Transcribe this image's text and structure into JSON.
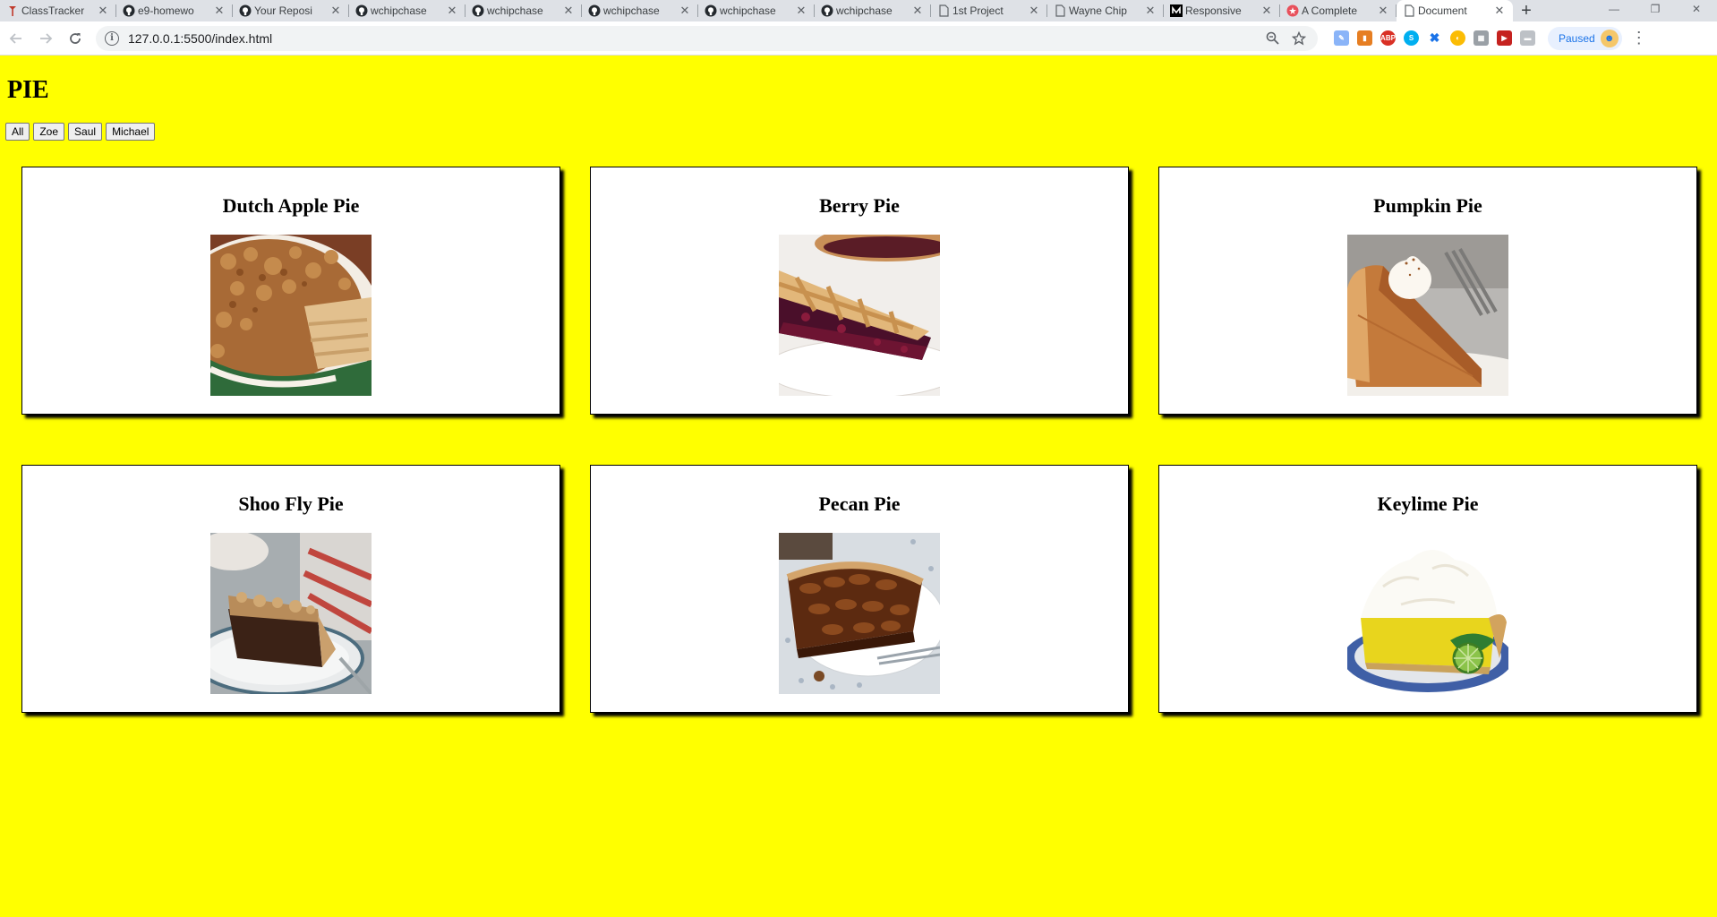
{
  "browser": {
    "tabs": [
      {
        "title": "ClassTracker",
        "icon": "classtracker-icon"
      },
      {
        "title": "e9-homewo",
        "icon": "github-icon"
      },
      {
        "title": "Your Reposi",
        "icon": "github-icon"
      },
      {
        "title": "wchipchase",
        "icon": "github-icon"
      },
      {
        "title": "wchipchase",
        "icon": "github-icon"
      },
      {
        "title": "wchipchase",
        "icon": "github-icon"
      },
      {
        "title": "wchipchase",
        "icon": "github-icon"
      },
      {
        "title": "wchipchase",
        "icon": "github-icon"
      },
      {
        "title": "1st Project",
        "icon": "page-icon"
      },
      {
        "title": "Wayne Chip",
        "icon": "page-icon"
      },
      {
        "title": "Responsive",
        "icon": "medium-icon"
      },
      {
        "title": "A Complete",
        "icon": "star-logo-icon"
      },
      {
        "title": "Document",
        "icon": "page-icon",
        "active": true
      }
    ],
    "url": "127.0.0.1:5500/index.html",
    "paused_label": "Paused"
  },
  "page": {
    "heading": "PIE",
    "filters": [
      "All",
      "Zoe",
      "Saul",
      "Michael"
    ],
    "pies": [
      {
        "name": "Dutch Apple Pie",
        "image": "dutch-apple-pie-photo"
      },
      {
        "name": "Berry Pie",
        "image": "berry-pie-photo"
      },
      {
        "name": "Pumpkin Pie",
        "image": "pumpkin-pie-photo"
      },
      {
        "name": "Shoo Fly Pie",
        "image": "shoo-fly-pie-photo"
      },
      {
        "name": "Pecan Pie",
        "image": "pecan-pie-photo"
      },
      {
        "name": "Keylime Pie",
        "image": "keylime-pie-photo"
      }
    ]
  },
  "colors": {
    "page_background": "#ffff00",
    "card_background": "#ffffff",
    "card_border": "#000000"
  }
}
